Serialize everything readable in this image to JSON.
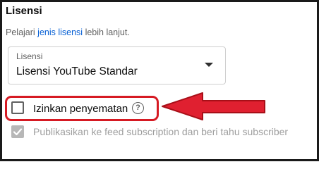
{
  "section": {
    "title": "Lisensi"
  },
  "description": {
    "prefix": "Pelajari ",
    "link": "jenis lisensi",
    "suffix": " lebih lanjut."
  },
  "license_select": {
    "label": "Lisensi",
    "value": "Lisensi YouTube Standar",
    "icon": "dropdown-arrow-icon"
  },
  "embed_option": {
    "label": "Izinkan penyematan",
    "checked": false,
    "help_icon": "?",
    "highlight_color": "#d61a23"
  },
  "publish_option": {
    "label": "Publikasikan ke feed subscription dan beri tahu subscriber",
    "checked": true,
    "disabled": true
  },
  "colors": {
    "accent_link": "#065fd4",
    "annotation_red": "#e02030"
  }
}
